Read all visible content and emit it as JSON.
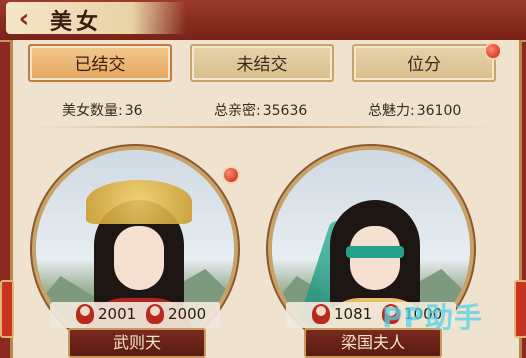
{
  "header": {
    "back_symbol": "‹",
    "title": "美女"
  },
  "tabs": [
    {
      "label": "已结交",
      "active": true
    },
    {
      "label": "未结交",
      "active": false
    },
    {
      "label": "位分",
      "active": false
    }
  ],
  "stats": {
    "count_label": "美女数量:",
    "count_value": "36",
    "intimacy_label": "总亲密:",
    "intimacy_value": "35636",
    "charm_label": "总魅力:",
    "charm_value": "36100"
  },
  "beauties": [
    {
      "name": "武则天",
      "value_a": "2001",
      "value_b": "2000"
    },
    {
      "name": "梁国夫人",
      "value_a": "1081",
      "value_b": "1000"
    }
  ],
  "watermark": "PP助手",
  "colors": {
    "accent_red": "#c82014",
    "tab_active": "#e5a562",
    "panel_bg": "#efe3cf"
  }
}
